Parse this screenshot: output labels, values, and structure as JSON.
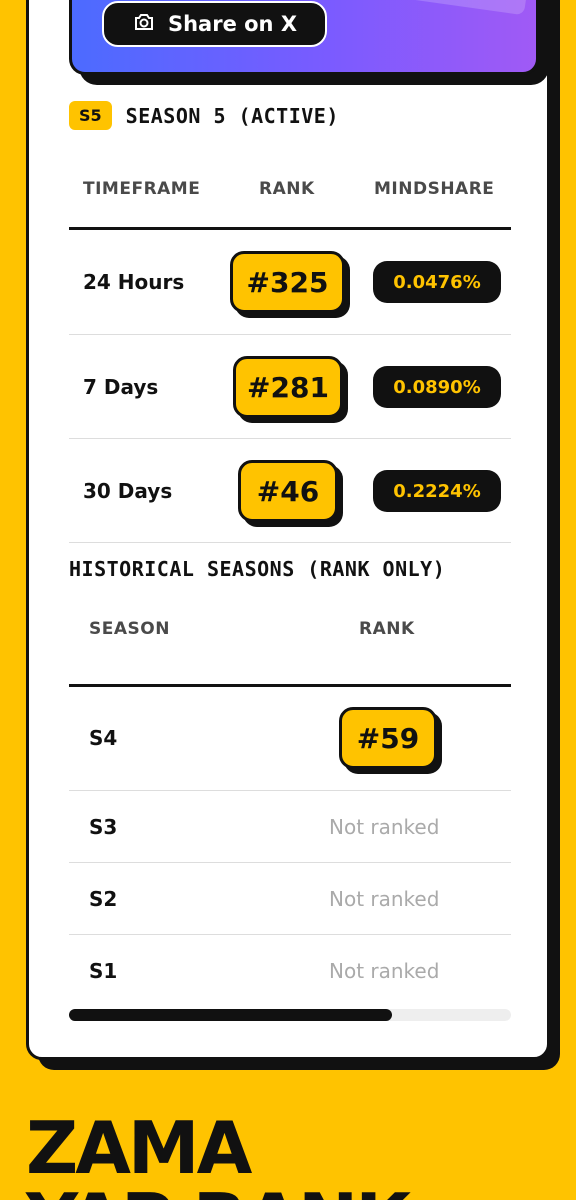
{
  "share": {
    "label": "Share on X",
    "icon": "camera-icon"
  },
  "season": {
    "badge": "S5",
    "title": "SEASON 5 (ACTIVE)"
  },
  "table": {
    "headers": {
      "timeframe": "TIMEFRAME",
      "rank": "RANK",
      "mindshare": "MINDSHARE"
    },
    "rows": [
      {
        "timeframe": "24 Hours",
        "rank": "#325",
        "mindshare": "0.0476%"
      },
      {
        "timeframe": "7 Days",
        "rank": "#281",
        "mindshare": "0.0890%"
      },
      {
        "timeframe": "30 Days",
        "rank": "#46",
        "mindshare": "0.2224%"
      }
    ]
  },
  "historical": {
    "title": "HISTORICAL SEASONS (RANK ONLY)",
    "headers": {
      "season": "SEASON",
      "rank": "RANK"
    },
    "rows": [
      {
        "season": "S4",
        "rank": "#59"
      },
      {
        "season": "S3",
        "rank": "Not ranked"
      },
      {
        "season": "S2",
        "rank": "Not ranked"
      },
      {
        "season": "S1",
        "rank": "Not ranked"
      }
    ]
  },
  "scroll": {
    "progress": 0.73
  },
  "brand": {
    "line1": "ZAMA",
    "line2": "YAP RANK"
  },
  "colors": {
    "accent": "#FFC300",
    "ink": "#111111",
    "muted": "#AAAAAA"
  }
}
